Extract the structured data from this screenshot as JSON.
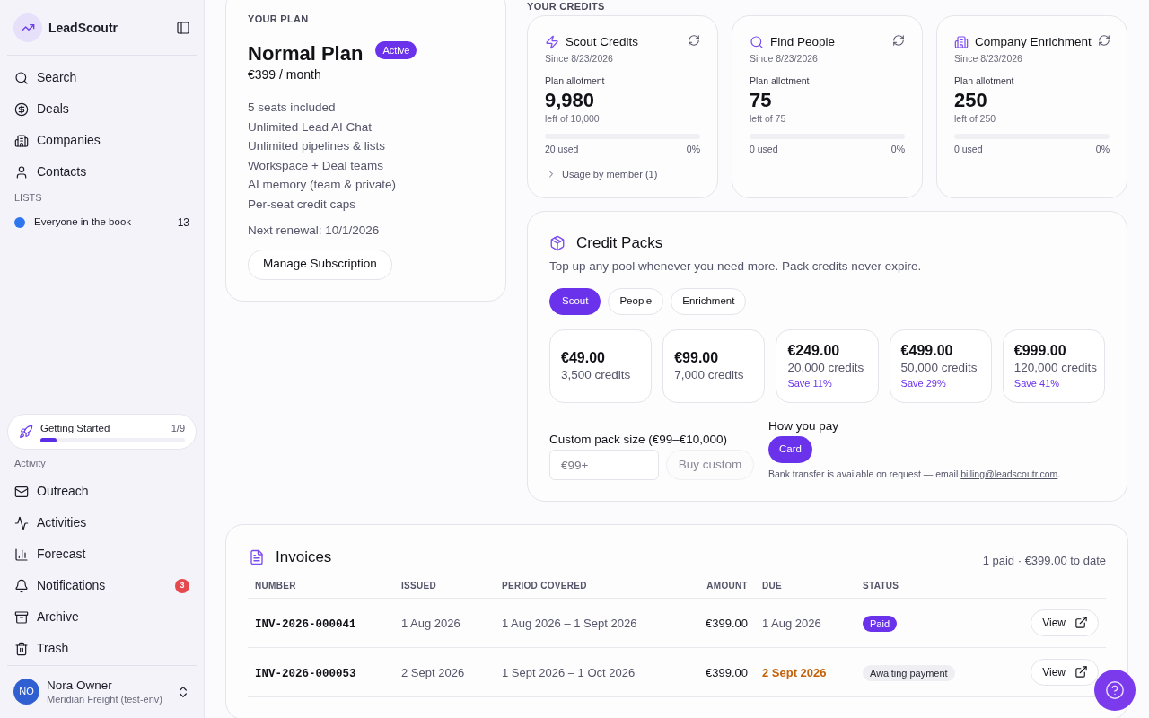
{
  "sidebar": {
    "brand": "LeadScoutr",
    "nav": [
      {
        "label": "Search"
      },
      {
        "label": "Deals"
      },
      {
        "label": "Companies"
      },
      {
        "label": "Contacts"
      }
    ],
    "lists_heading": "LISTS",
    "lists": [
      {
        "label": "Everyone in the book",
        "count": "13",
        "color": "#2f76ee"
      }
    ],
    "onboarding": {
      "title": "Getting Started",
      "steps": "1/9",
      "level": 0.11
    },
    "activity_heading": "Activity",
    "activity_nav": [
      {
        "label": "Outreach"
      },
      {
        "label": "Activities"
      },
      {
        "label": "Forecast"
      },
      {
        "label": "Notifications",
        "badge": "3"
      },
      {
        "label": "Archive"
      },
      {
        "label": "Trash"
      }
    ],
    "user": {
      "initials": "NO",
      "name": "Nora Owner",
      "org": "Meridian Freight (test-env)"
    }
  },
  "plan": {
    "heading": "YOUR PLAN",
    "name": "Normal Plan",
    "status": "Active",
    "price": "€399 / month",
    "features": [
      "5 seats included",
      "Unlimited Lead AI Chat",
      "Unlimited pipelines & lists",
      "Workspace + Deal teams",
      "AI memory (team & private)",
      "Per-seat credit caps"
    ],
    "renewal": "Next renewal: 10/1/2026",
    "button": "Manage Subscription"
  },
  "credits": {
    "heading": "YOUR CREDITS",
    "cards": [
      {
        "title": "Scout Credits",
        "since": "Since 8/23/2026",
        "allotment_label": "Plan allotment",
        "remaining": "9,980",
        "of_total": "left of 10,000",
        "used": "20 used",
        "percent": "0%",
        "usage_link": "Usage by member (1)"
      },
      {
        "title": "Find People",
        "since": "Since 8/23/2026",
        "allotment_label": "Plan allotment",
        "remaining": "75",
        "of_total": "left of 75",
        "used": "0 used",
        "percent": "0%"
      },
      {
        "title": "Company Enrichment",
        "since": "Since 8/23/2026",
        "allotment_label": "Plan allotment",
        "remaining": "250",
        "of_total": "left of 250",
        "used": "0 used",
        "percent": "0%"
      }
    ]
  },
  "credit_packs": {
    "title": "Credit Packs",
    "subtitle": "Top up any pool whenever you need more. Pack credits never expire.",
    "tabs": [
      {
        "label": "Scout",
        "selected": true
      },
      {
        "label": "People",
        "selected": false
      },
      {
        "label": "Enrichment",
        "selected": false
      }
    ],
    "packs": [
      {
        "price": "€49.00",
        "credits": "3,500 credits"
      },
      {
        "price": "€99.00",
        "credits": "7,000 credits"
      },
      {
        "price": "€249.00",
        "credits": "20,000 credits",
        "saving": "Save 11%"
      },
      {
        "price": "€499.00",
        "credits": "50,000 credits",
        "saving": "Save 29%"
      },
      {
        "price": "€999.00",
        "credits": "120,000 credits",
        "saving": "Save 41%"
      }
    ],
    "custom": {
      "label": "Custom pack size (€99–€10,000)",
      "placeholder": "€99+",
      "button": "Buy custom",
      "disabled": true
    },
    "payment": {
      "heading": "How you pay",
      "methods": [
        {
          "label": "Card",
          "selected": true
        }
      ],
      "note_prefix": "Bank transfer is available on request — email ",
      "note_link": "billing@leadscoutr.com",
      "note_suffix": "."
    }
  },
  "invoices": {
    "title": "Invoices",
    "summary": "1 paid · €399.00 to date",
    "columns": [
      "NUMBER",
      "ISSUED",
      "PERIOD COVERED",
      "AMOUNT",
      "DUE",
      "STATUS"
    ],
    "rows": [
      {
        "number": "INV-2026-000041",
        "issued": "1 Aug 2026",
        "period": "1 Aug 2026 – 1 Sept 2026",
        "amount": "€399.00",
        "due": "1 Aug 2026",
        "overdue": false,
        "status": "Paid",
        "paid": true,
        "action": "View"
      },
      {
        "number": "INV-2026-000053",
        "issued": "2 Sept 2026",
        "period": "1 Sept 2026 – 1 Oct 2026",
        "amount": "€399.00",
        "due": "2 Sept 2026",
        "overdue": true,
        "status": "Awaiting payment",
        "paid": false,
        "action": "View"
      }
    ]
  }
}
